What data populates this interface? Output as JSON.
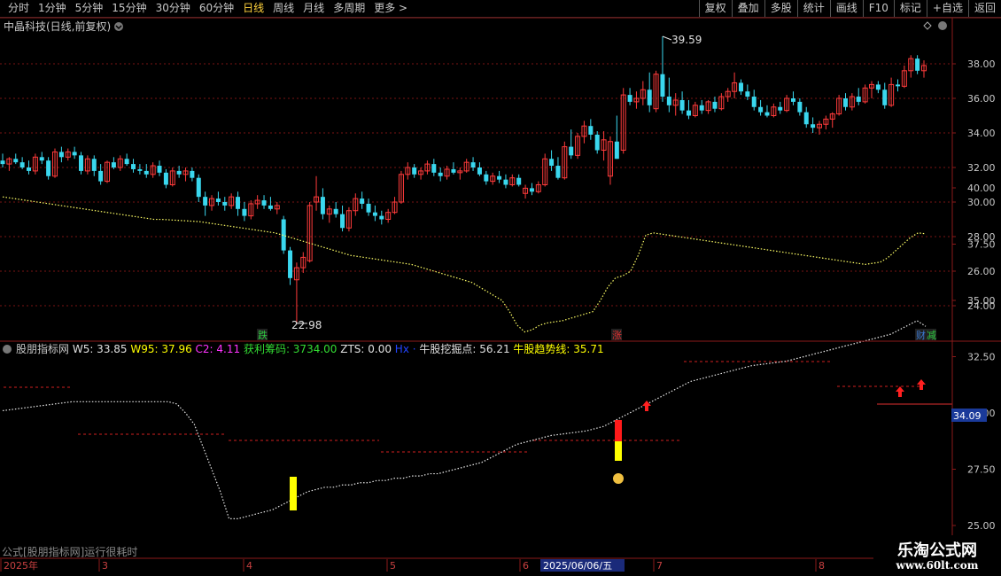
{
  "toolbar": {
    "periods": [
      "分时",
      "1分钟",
      "5分钟",
      "15分钟",
      "30分钟",
      "60分钟",
      "日线",
      "周线",
      "月线",
      "多周期",
      "更多"
    ],
    "active_period": "日线",
    "more_arrow": ">",
    "right_buttons": [
      "复权",
      "叠加",
      "多股",
      "统计",
      "画线",
      "F10",
      "标记",
      "+自选",
      "返回"
    ]
  },
  "main_panel": {
    "title": "中晶科技(日线,前复权)",
    "high_label": "39.59",
    "low_label": "22.98",
    "event_tags": [
      {
        "text": "跌",
        "color": "#2ecc40"
      },
      {
        "text": "涨",
        "color": "#e03030"
      },
      {
        "text": "财",
        "color": "#3a78d0"
      },
      {
        "text": "减",
        "color": "#2ecc40"
      }
    ]
  },
  "indicator": {
    "name": "股朋指标网",
    "values": [
      {
        "label": "W5: 33.85",
        "color": "#e0e0e0"
      },
      {
        "label": "W95: 37.96",
        "color": "#ffff00"
      },
      {
        "label": "C2: 4.11",
        "color": "#ff33ff"
      },
      {
        "label": "获利筹码: 3734.00",
        "color": "#33dd33"
      },
      {
        "label": "ZTS: 0.00",
        "color": "#e0e0e0"
      },
      {
        "label": "Hx",
        "color": "#2244ff"
      },
      {
        "label": "·",
        "color": "#2244ff"
      },
      {
        "label": "牛股挖掘点: 56.21",
        "color": "#e0e0e0"
      },
      {
        "label": "牛股趋势线: 35.71",
        "color": "#ffff00"
      }
    ],
    "current_value_label": "34.09"
  },
  "status_text": "公式[股朋指标网]运行很耗时",
  "date_axis": {
    "labels": [
      "2025年",
      "3",
      "4",
      "5",
      "6",
      "7",
      "8"
    ],
    "highlight": "2025/06/06/五"
  },
  "watermark": {
    "title": "乐淘公式网",
    "url": "www.60lt.com"
  },
  "colors": {
    "up": "#ff3b3b",
    "down": "#3ad7ee",
    "grid": "#7a1515",
    "axis": "#8b1a1a",
    "dotted_white": "#e8e8e8",
    "dotted_yellow": "#ffff66"
  },
  "chart_data": [
    {
      "type": "candlestick",
      "title": "中晶科技(日线,前复权)",
      "ylim": [
        23,
        39.6
      ],
      "yticks": [
        24,
        26,
        28,
        30,
        32,
        34,
        36,
        38
      ],
      "ohlc": [
        [
          32.4,
          32.8,
          32.0,
          32.2
        ],
        [
          32.2,
          32.6,
          31.8,
          32.5
        ],
        [
          32.5,
          32.8,
          32.2,
          32.3
        ],
        [
          32.3,
          32.6,
          31.9,
          32.0
        ],
        [
          32.0,
          32.4,
          31.6,
          31.8
        ],
        [
          31.8,
          32.8,
          31.6,
          32.6
        ],
        [
          32.6,
          32.9,
          32.2,
          32.4
        ],
        [
          32.4,
          32.6,
          31.3,
          31.5
        ],
        [
          31.5,
          33.1,
          31.4,
          32.9
        ],
        [
          32.9,
          33.2,
          32.3,
          32.6
        ],
        [
          32.6,
          33.1,
          32.4,
          32.9
        ],
        [
          32.9,
          33.2,
          32.5,
          32.7
        ],
        [
          32.7,
          32.9,
          31.6,
          31.8
        ],
        [
          31.8,
          32.7,
          31.6,
          32.5
        ],
        [
          32.5,
          32.7,
          31.5,
          31.8
        ],
        [
          31.8,
          32.2,
          31.0,
          31.2
        ],
        [
          31.2,
          32.4,
          31.1,
          32.3
        ],
        [
          32.3,
          32.6,
          31.9,
          32.0
        ],
        [
          32.0,
          32.7,
          31.8,
          32.5
        ],
        [
          32.5,
          32.8,
          32.1,
          32.2
        ],
        [
          32.2,
          32.5,
          31.7,
          31.9
        ],
        [
          31.9,
          32.2,
          31.6,
          31.8
        ],
        [
          31.8,
          32.2,
          31.4,
          31.6
        ],
        [
          31.6,
          32.3,
          31.4,
          32.1
        ],
        [
          32.1,
          32.4,
          31.5,
          31.7
        ],
        [
          31.7,
          31.9,
          30.8,
          31.0
        ],
        [
          31.0,
          32.0,
          30.9,
          31.8
        ],
        [
          31.8,
          32.1,
          31.4,
          31.6
        ],
        [
          31.6,
          32.0,
          31.2,
          31.8
        ],
        [
          31.8,
          32.0,
          31.2,
          31.4
        ],
        [
          31.4,
          31.6,
          30.0,
          30.3
        ],
        [
          30.3,
          30.6,
          29.2,
          29.8
        ],
        [
          29.8,
          30.4,
          29.5,
          30.2
        ],
        [
          30.2,
          30.6,
          29.8,
          30.0
        ],
        [
          30.0,
          30.3,
          29.5,
          29.8
        ],
        [
          29.8,
          30.5,
          29.6,
          30.3
        ],
        [
          30.3,
          30.6,
          29.2,
          29.6
        ],
        [
          29.6,
          30.0,
          28.9,
          29.2
        ],
        [
          29.2,
          30.1,
          29.0,
          29.9
        ],
        [
          29.9,
          30.4,
          29.6,
          30.1
        ],
        [
          30.1,
          30.4,
          29.6,
          29.8
        ],
        [
          29.8,
          30.3,
          29.5,
          29.6
        ],
        [
          29.6,
          30.0,
          29.3,
          29.8
        ],
        [
          29.0,
          29.2,
          27.0,
          27.2
        ],
        [
          27.2,
          27.4,
          25.2,
          25.6
        ],
        [
          25.5,
          26.5,
          22.98,
          26.2
        ],
        [
          26.2,
          27.1,
          25.9,
          26.8
        ],
        [
          26.6,
          30.0,
          26.5,
          29.8
        ],
        [
          30.0,
          31.5,
          29.5,
          30.3
        ],
        [
          30.3,
          30.8,
          29.0,
          29.3
        ],
        [
          29.3,
          29.8,
          28.8,
          29.6
        ],
        [
          29.6,
          30.0,
          29.1,
          29.3
        ],
        [
          29.3,
          29.8,
          28.3,
          28.5
        ],
        [
          28.5,
          29.7,
          28.3,
          29.5
        ],
        [
          29.5,
          30.5,
          29.2,
          30.2
        ],
        [
          30.2,
          30.6,
          29.6,
          29.9
        ],
        [
          29.9,
          30.2,
          29.2,
          29.4
        ],
        [
          29.4,
          29.8,
          28.9,
          29.2
        ],
        [
          29.2,
          29.5,
          28.7,
          29.0
        ],
        [
          29.0,
          29.6,
          28.8,
          29.4
        ],
        [
          29.4,
          30.3,
          29.3,
          30.0
        ],
        [
          30.0,
          31.8,
          29.9,
          31.6
        ],
        [
          31.6,
          32.3,
          31.3,
          32.0
        ],
        [
          32.0,
          32.2,
          31.4,
          31.6
        ],
        [
          31.6,
          32.0,
          31.3,
          31.8
        ],
        [
          31.8,
          32.4,
          31.6,
          32.2
        ],
        [
          32.2,
          32.5,
          31.5,
          31.7
        ],
        [
          31.7,
          32.0,
          31.2,
          31.5
        ],
        [
          31.5,
          32.1,
          31.3,
          31.9
        ],
        [
          31.9,
          32.3,
          31.6,
          31.7
        ],
        [
          31.7,
          32.0,
          31.3,
          31.8
        ],
        [
          31.8,
          32.5,
          31.7,
          32.3
        ],
        [
          32.3,
          32.6,
          31.8,
          32.0
        ],
        [
          32.0,
          32.3,
          31.5,
          31.6
        ],
        [
          31.6,
          31.8,
          31.0,
          31.2
        ],
        [
          31.2,
          31.7,
          31.0,
          31.5
        ],
        [
          31.5,
          31.8,
          31.1,
          31.3
        ],
        [
          31.3,
          31.6,
          30.8,
          31.0
        ],
        [
          31.0,
          31.6,
          30.9,
          31.4
        ],
        [
          31.4,
          31.6,
          30.9,
          31.0
        ],
        [
          30.5,
          31.0,
          30.2,
          30.8
        ],
        [
          30.8,
          31.1,
          30.4,
          30.6
        ],
        [
          30.6,
          31.2,
          30.5,
          31.0
        ],
        [
          31.0,
          32.8,
          30.9,
          32.5
        ],
        [
          32.5,
          33.0,
          31.8,
          32.1
        ],
        [
          32.1,
          32.6,
          31.3,
          31.4
        ],
        [
          31.4,
          33.5,
          31.3,
          33.2
        ],
        [
          33.2,
          34.2,
          32.5,
          32.7
        ],
        [
          32.7,
          34.0,
          32.5,
          33.8
        ],
        [
          33.8,
          34.7,
          33.4,
          34.4
        ],
        [
          34.4,
          34.8,
          33.6,
          33.9
        ],
        [
          33.9,
          34.1,
          32.8,
          33.0
        ],
        [
          33.0,
          34.1,
          32.4,
          33.6
        ],
        [
          31.5,
          33.8,
          31.0,
          33.5
        ],
        [
          33.5,
          35.0,
          32.5,
          32.5
        ],
        [
          33.0,
          36.6,
          32.8,
          36.2
        ],
        [
          36.2,
          36.6,
          35.6,
          35.8
        ],
        [
          35.8,
          36.4,
          35.4,
          36.0
        ],
        [
          36.0,
          37.0,
          35.6,
          36.5
        ],
        [
          36.5,
          37.5,
          35.2,
          35.6
        ],
        [
          35.4,
          37.6,
          35.2,
          37.4
        ],
        [
          37.4,
          39.59,
          35.8,
          36.1
        ],
        [
          36.1,
          37.2,
          35.2,
          35.6
        ],
        [
          35.6,
          36.3,
          35.0,
          35.9
        ],
        [
          35.9,
          36.4,
          35.1,
          35.3
        ],
        [
          35.3,
          35.9,
          34.8,
          35.0
        ],
        [
          35.0,
          35.8,
          34.9,
          35.6
        ],
        [
          35.6,
          35.9,
          35.1,
          35.3
        ],
        [
          35.3,
          35.9,
          35.1,
          35.8
        ],
        [
          35.8,
          36.1,
          35.2,
          35.4
        ],
        [
          35.4,
          36.3,
          35.3,
          36.1
        ],
        [
          36.1,
          36.6,
          35.8,
          36.4
        ],
        [
          36.4,
          37.5,
          36.0,
          36.9
        ],
        [
          36.9,
          37.1,
          36.2,
          36.4
        ],
        [
          36.4,
          36.8,
          35.9,
          36.1
        ],
        [
          36.1,
          36.5,
          35.3,
          35.5
        ],
        [
          35.5,
          35.9,
          35.0,
          35.2
        ],
        [
          35.2,
          35.6,
          34.9,
          35.0
        ],
        [
          35.0,
          35.7,
          34.9,
          35.5
        ],
        [
          35.5,
          35.8,
          35.1,
          35.3
        ],
        [
          35.3,
          36.2,
          35.2,
          36.0
        ],
        [
          36.0,
          36.4,
          35.6,
          35.8
        ],
        [
          35.8,
          36.0,
          35.0,
          35.2
        ],
        [
          35.2,
          35.5,
          34.3,
          34.5
        ],
        [
          34.5,
          34.9,
          34.0,
          34.3
        ],
        [
          34.3,
          34.7,
          33.9,
          34.5
        ],
        [
          34.5,
          35.0,
          34.2,
          34.8
        ],
        [
          34.8,
          35.2,
          34.3,
          35.1
        ],
        [
          35.1,
          36.2,
          35.0,
          36.0
        ],
        [
          36.0,
          36.3,
          35.3,
          35.5
        ],
        [
          35.5,
          36.3,
          35.3,
          36.1
        ],
        [
          36.1,
          36.6,
          35.6,
          35.8
        ],
        [
          35.8,
          36.8,
          35.7,
          36.6
        ],
        [
          36.6,
          37.0,
          36.0,
          36.8
        ],
        [
          36.8,
          37.0,
          36.3,
          36.5
        ],
        [
          36.5,
          36.9,
          35.4,
          35.6
        ],
        [
          35.6,
          37.2,
          35.5,
          36.8
        ],
        [
          36.8,
          37.1,
          36.4,
          36.7
        ],
        [
          36.7,
          37.9,
          36.6,
          37.6
        ],
        [
          37.6,
          38.5,
          37.2,
          38.3
        ],
        [
          38.3,
          38.5,
          37.4,
          37.6
        ],
        [
          37.6,
          38.2,
          37.2,
          37.9
        ]
      ]
    },
    {
      "type": "line",
      "title": "股朋指标网",
      "ylim": [
        25,
        41
      ],
      "yticks": [
        25.0,
        27.5,
        30.0,
        32.5,
        35.0,
        37.5,
        40.0
      ],
      "series": [
        {
          "name": "W95",
          "style": "dotted-yellow",
          "values": [
            39.6,
            39.55,
            39.5,
            39.45,
            39.4,
            39.35,
            39.3,
            39.25,
            39.2,
            39.15,
            39.1,
            39.05,
            39.0,
            38.95,
            38.9,
            38.85,
            38.8,
            38.75,
            38.7,
            38.65,
            38.6,
            38.6,
            38.58,
            38.56,
            38.54,
            38.52,
            38.5,
            38.45,
            38.4,
            38.35,
            38.3,
            38.25,
            38.2,
            38.15,
            38.1,
            38.05,
            38.0,
            37.9,
            37.8,
            37.7,
            37.6,
            37.5,
            37.4,
            37.3,
            37.2,
            37.1,
            37.0,
            36.95,
            36.9,
            36.85,
            36.8,
            36.75,
            36.7,
            36.65,
            36.6,
            36.5,
            36.4,
            36.3,
            36.2,
            36.1,
            36.0,
            35.9,
            35.8,
            35.6,
            35.4,
            35.2,
            35.0,
            34.5,
            33.9,
            33.6,
            33.7,
            33.9,
            34.0,
            34.05,
            34.1,
            34.2,
            34.3,
            34.4,
            34.5,
            35.0,
            35.6,
            36.0,
            36.1,
            36.3,
            37.0,
            37.9,
            38.0,
            37.95,
            37.9,
            37.85,
            37.8,
            37.75,
            37.7,
            37.65,
            37.6,
            37.55,
            37.5,
            37.45,
            37.4,
            37.35,
            37.3,
            37.25,
            37.2,
            37.15,
            37.1,
            37.05,
            37.0,
            36.95,
            36.9,
            36.85,
            36.8,
            36.75,
            36.7,
            36.65,
            36.6,
            36.65,
            36.7,
            36.9,
            37.2,
            37.5,
            37.8,
            38.0,
            37.96
          ]
        },
        {
          "name": "W5",
          "style": "dotted-white",
          "values": [
            30.1,
            30.15,
            30.2,
            30.25,
            30.3,
            30.35,
            30.4,
            30.45,
            30.5,
            30.5,
            30.5,
            30.5,
            30.5,
            30.5,
            30.5,
            30.5,
            30.5,
            30.5,
            30.5,
            30.5,
            30.4,
            30.0,
            29.5,
            28.5,
            27.5,
            26.5,
            25.3,
            25.3,
            25.4,
            25.5,
            25.6,
            25.7,
            25.9,
            26.1,
            26.3,
            26.5,
            26.6,
            26.7,
            26.7,
            26.8,
            26.8,
            26.9,
            26.9,
            27.0,
            27.0,
            27.1,
            27.1,
            27.2,
            27.2,
            27.3,
            27.3,
            27.4,
            27.5,
            27.6,
            27.7,
            27.8,
            28.0,
            28.2,
            28.4,
            28.6,
            28.7,
            28.8,
            28.9,
            29.0,
            29.05,
            29.1,
            29.15,
            29.2,
            29.3,
            29.4,
            29.6,
            29.8,
            30.0,
            30.2,
            30.4,
            30.6,
            30.8,
            31.0,
            31.2,
            31.4,
            31.5,
            31.6,
            31.7,
            31.8,
            31.9,
            32.0,
            32.1,
            32.15,
            32.2,
            32.25,
            32.3,
            32.4,
            32.5,
            32.6,
            32.7,
            32.8,
            32.9,
            33.0,
            33.1,
            33.2,
            33.3,
            33.4,
            33.5,
            33.7,
            33.9,
            34.1,
            33.85
          ]
        }
      ]
    }
  ]
}
